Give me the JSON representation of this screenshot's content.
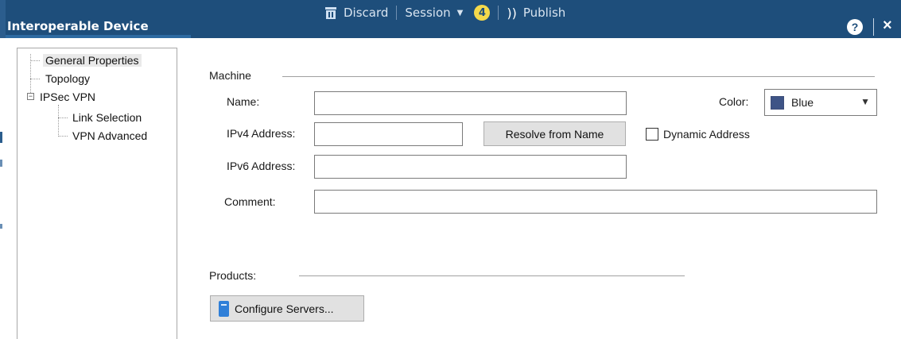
{
  "window": {
    "title": "Interoperable Device"
  },
  "session_bar": {
    "discard_label": "Discard",
    "session_label": "Session",
    "session_count": "4",
    "publish_label": "Publish"
  },
  "title_controls": {
    "help_glyph": "?",
    "close_glyph": "×"
  },
  "tree": {
    "items": [
      {
        "label": "General Properties",
        "selected": true
      },
      {
        "label": "Topology"
      },
      {
        "label": "IPSec VPN",
        "expanded": true
      },
      {
        "label": "Link Selection"
      },
      {
        "label": "VPN Advanced"
      }
    ],
    "expander_glyph": "−"
  },
  "machine": {
    "group_label": "Machine",
    "name_label": "Name:",
    "name_value": "",
    "color_label": "Color:",
    "color_value": "Blue",
    "color_swatch": "#3e5486",
    "ipv4_label": "IPv4 Address:",
    "ipv4_value": "",
    "resolve_button": "Resolve from Name",
    "dynamic_address_label": "Dynamic Address",
    "dynamic_address_checked": false,
    "ipv6_label": "IPv6 Address:",
    "ipv6_value": "",
    "comment_label": "Comment:",
    "comment_value": ""
  },
  "products": {
    "group_label": "Products:",
    "configure_button": "Configure Servers..."
  },
  "colors": {
    "titlebar": "#1e4e7b",
    "badge": "#f4d94b",
    "button_face": "#e1e1e1"
  }
}
